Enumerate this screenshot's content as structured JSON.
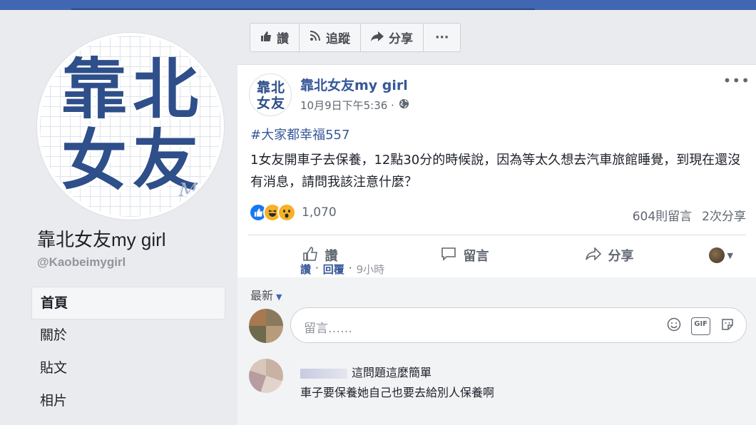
{
  "page": {
    "name": "靠北女友my girl",
    "handle": "@Kaobeimygirl",
    "avatar_text": [
      "靠",
      "北",
      "女",
      "友"
    ],
    "avatar_signature": "My",
    "nav": [
      "首頁",
      "關於",
      "貼文",
      "相片"
    ]
  },
  "actionbar": [
    {
      "label": "讚",
      "icon": "thumbs-up-icon"
    },
    {
      "label": "追蹤",
      "icon": "rss-icon"
    },
    {
      "label": "分享",
      "icon": "share-arrow-icon"
    },
    {
      "label": "···",
      "icon": "more-icon"
    }
  ],
  "post": {
    "author": "靠北女友my girl",
    "timestamp": "10月9日下午5:36 ·",
    "privacy_icon": "globe-icon",
    "hashtag": "#大家都幸福557",
    "text": "1女友開車子去保養，12點30分的時候說，因為等太久想去汽車旅館睡覺，到現在還沒有消息，請問我該注意什麼？",
    "reactions": {
      "types": [
        "like",
        "haha",
        "wow"
      ],
      "count": "1,070"
    },
    "comment_count": "604則留言",
    "share_count": "2次分享",
    "buttons": [
      "讚",
      "留言",
      "分享"
    ]
  },
  "comments": {
    "sort_label": "最新",
    "input_placeholder": "留言……",
    "items": [
      {
        "line1": "這問題這麼簡單",
        "line2": "車子要保養她自己也要去給別人保養啊",
        "like": "讚",
        "reply": "回覆",
        "time": "9小時"
      }
    ]
  },
  "colors": {
    "brand": "#4267b2",
    "link": "#365899",
    "background": "#e9ebee"
  }
}
